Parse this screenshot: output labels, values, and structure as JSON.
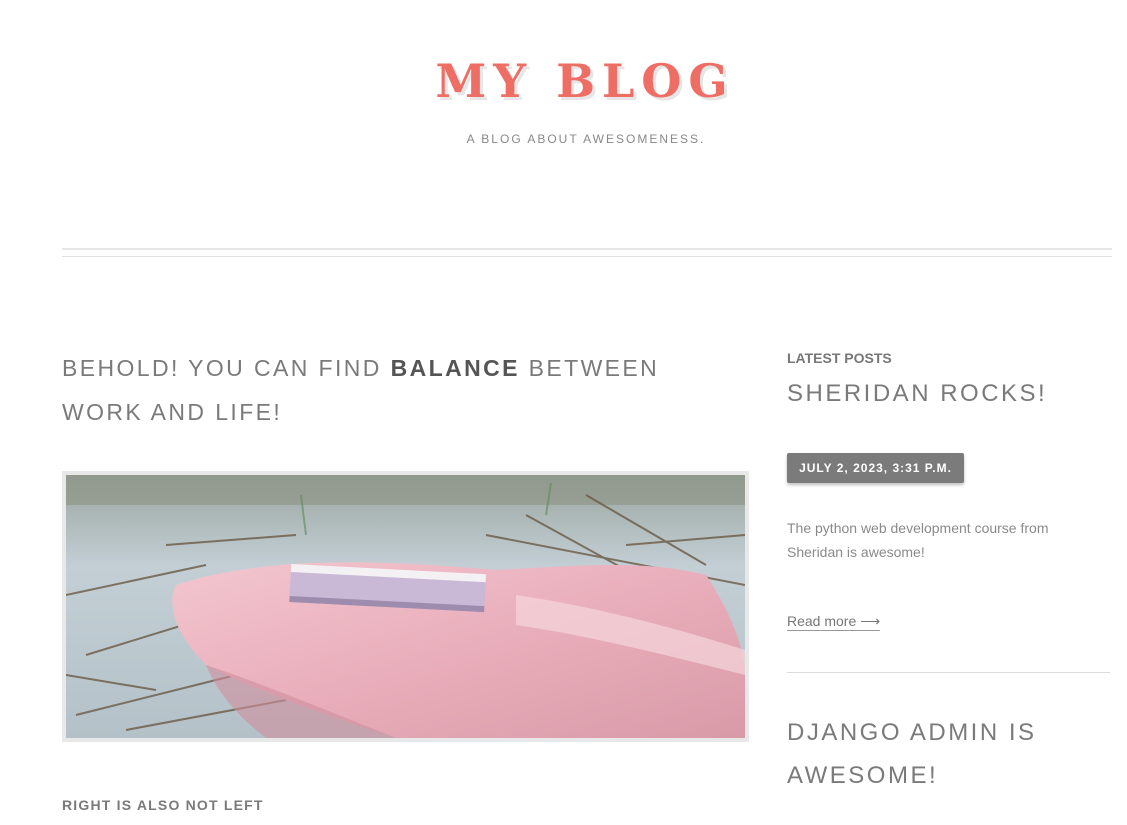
{
  "header": {
    "title": "MY BLOG",
    "tagline": "A BLOG ABOUT AWESOMENESS."
  },
  "main": {
    "post_title_part1": "BEHOLD! YOU CAN FIND ",
    "post_title_emphasis": "BALANCE",
    "post_title_part2": " BETWEEN WORK AND LIFE!",
    "sub_heading": "RIGHT IS ALSO NOT LEFT"
  },
  "sidebar": {
    "heading": "LATEST POSTS",
    "posts": [
      {
        "title": "SHERIDAN ROCKS!",
        "date": "JULY 2, 2023, 3:31 P.M.",
        "excerpt": "The python web development course from Sheridan is awesome!",
        "read_more": "Read more ⟶"
      },
      {
        "title": "DJANGO ADMIN IS AWESOME!"
      }
    ]
  },
  "colors": {
    "brand": "#ee6e66",
    "text": "#777777",
    "badge": "#7b7b7b"
  }
}
